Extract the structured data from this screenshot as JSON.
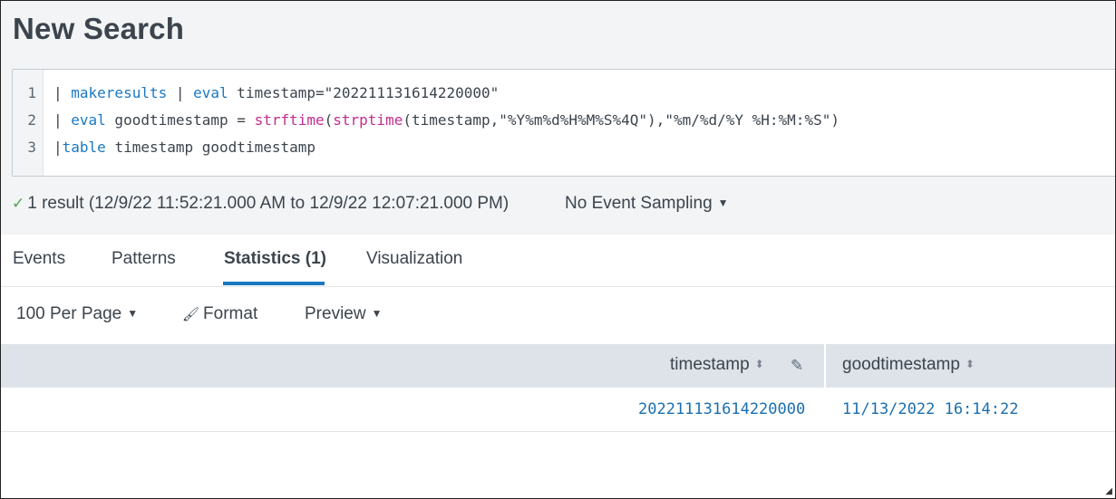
{
  "page": {
    "title": "New Search"
  },
  "editor": {
    "line_numbers": [
      "1",
      "2",
      "3"
    ],
    "lines": [
      {
        "pipe": "| ",
        "cmd": "makeresults",
        "sep": " | ",
        "cmd2": "eval",
        "rest": " timestamp=\"202211131614220000\""
      },
      {
        "pipe": "| ",
        "cmd": "eval",
        "mid": " goodtimestamp = ",
        "fn1": "strftime",
        "p1": "(",
        "fn2": "strptime",
        "rest": "(timestamp,\"%Y%m%d%H%M%S%4Q\"),\"%m/%d/%Y %H:%M:%S\")"
      },
      {
        "pipe": "|",
        "cmd": "table",
        "rest": " timestamp goodtimestamp"
      }
    ]
  },
  "status": {
    "result_text": "1 result (12/9/22 11:52:21.000 AM to 12/9/22 12:07:21.000 PM)",
    "sampling_label": "No Event Sampling"
  },
  "tabs": [
    {
      "label": "Events",
      "active": false
    },
    {
      "label": "Patterns",
      "active": false
    },
    {
      "label": "Statistics (1)",
      "active": true
    },
    {
      "label": "Visualization",
      "active": false
    }
  ],
  "toolbar": {
    "per_page": "100 Per Page",
    "format": "Format",
    "preview": "Preview"
  },
  "table": {
    "columns": [
      "timestamp",
      "goodtimestamp"
    ],
    "rows": [
      [
        "202211131614220000",
        "11/13/2022 16:14:22"
      ]
    ]
  },
  "icons": {
    "check": "check-icon",
    "caret": "caret-down-icon",
    "brush": "brush-icon",
    "sort": "sort-icon",
    "pencil": "pencil-icon"
  },
  "colors": {
    "keyword": "#1a78c2",
    "function": "#c42d8f",
    "success": "#53a051",
    "accent": "#1a78c2",
    "cell_value": "#1a6fb0"
  }
}
